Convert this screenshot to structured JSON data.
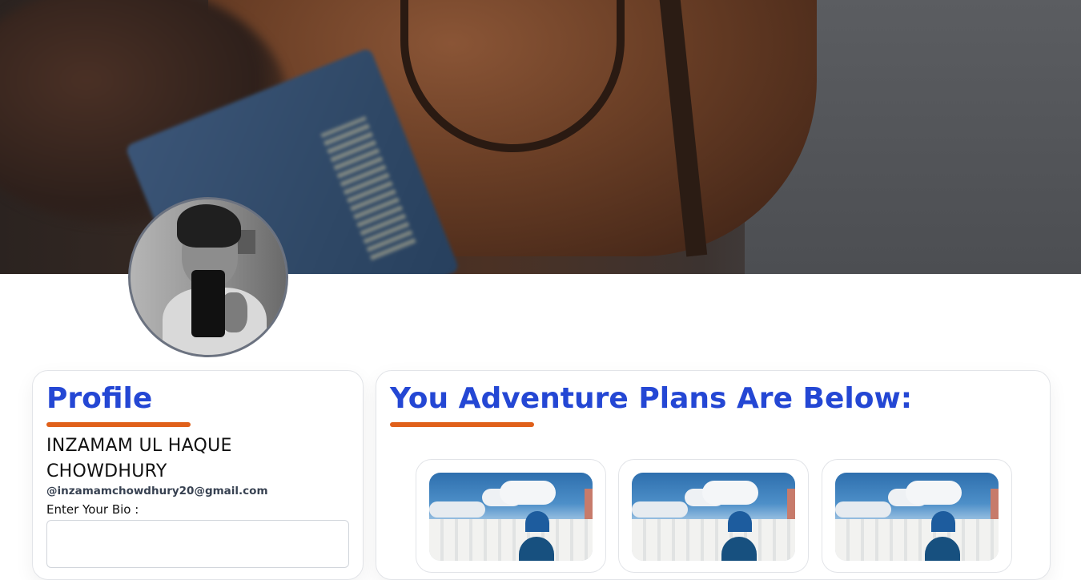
{
  "profile": {
    "heading": "Profile",
    "name": "INZAMAM UL HAQUE CHOWDHURY",
    "email": "@inzamamchowdhury20@gmail.com",
    "bio_label": "Enter Your Bio :",
    "bio_value": ""
  },
  "plans": {
    "heading": "You Adventure Plans Are Below:",
    "items": [
      {
        "image": "santorini-photo"
      },
      {
        "image": "santorini-photo"
      },
      {
        "image": "santorini-photo"
      }
    ]
  },
  "colors": {
    "heading": "#2447d4",
    "underline": "#e0601a",
    "card_border": "#e2e4e8"
  }
}
